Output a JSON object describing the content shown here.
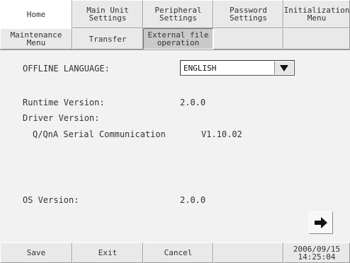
{
  "tabs_row1": [
    {
      "label": "Home"
    },
    {
      "label": "Main Unit\nSettings"
    },
    {
      "label": "Peripheral\nSettings"
    },
    {
      "label": "Password\nSettings"
    },
    {
      "label": "Initialization\nMenu"
    }
  ],
  "tabs_row2": [
    {
      "label": "Maintenance\nMenu"
    },
    {
      "label": "Transfer"
    },
    {
      "label": "External file\noperation"
    },
    {
      "label": ""
    },
    {
      "label": ""
    }
  ],
  "main": {
    "offline_language_label": "OFFLINE LANGUAGE:",
    "offline_language_value": "ENGLISH",
    "runtime_version_label": "Runtime Version:",
    "runtime_version_value": "2.0.0",
    "driver_version_label": "Driver Version:",
    "driver_name": "Q/QnA Serial Communication",
    "driver_version_value": "V1.10.02",
    "os_version_label": "OS Version:",
    "os_version_value": "2.0.0"
  },
  "bottom": {
    "save_label": "Save",
    "exit_label": "Exit",
    "cancel_label": "Cancel",
    "empty_label": "",
    "date": "2006/09/15",
    "time": "14:25:04"
  },
  "icons": {
    "dropdown": "triangle-down-icon",
    "next": "arrow-right-icon"
  }
}
